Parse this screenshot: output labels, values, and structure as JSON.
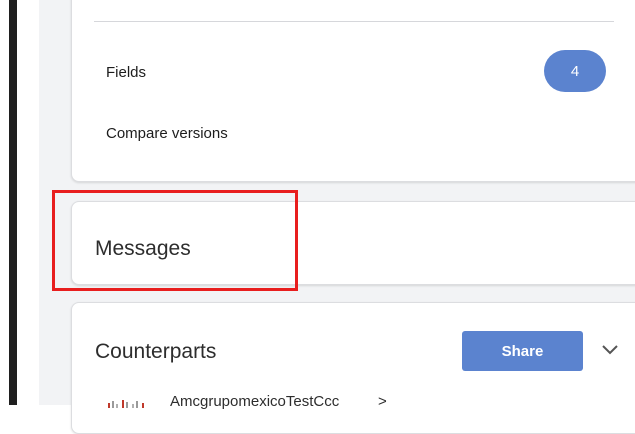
{
  "summary_card": {
    "fields_label": "Fields",
    "fields_count": "4",
    "compare_versions_label": "Compare versions"
  },
  "messages_card": {
    "title": "Messages"
  },
  "counterparts_card": {
    "title": "Counterparts",
    "share_label": "Share",
    "counterpart_name": "AmcgrupomexicoTestCcc",
    "counterpart_arrow": ">"
  },
  "colors": {
    "accent": "#5b83cf",
    "highlight": "#e81e1e"
  }
}
